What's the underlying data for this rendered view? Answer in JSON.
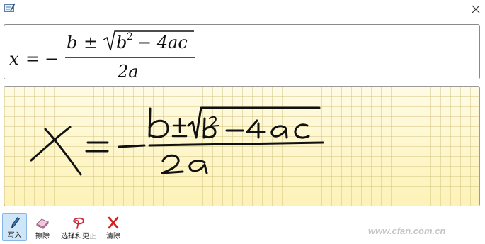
{
  "preview": {
    "lhs": "x",
    "eq": "=",
    "minus": "−",
    "numerator_b": "b",
    "pm": "±",
    "radicand_b": "b",
    "radicand_exp": "2",
    "radicand_rest": "− 4ac",
    "denominator": "2a"
  },
  "toolbar": {
    "write_label": "写入",
    "erase_label": "擦除",
    "select_correct_label": "选择和更正",
    "clear_label": "清除"
  },
  "watermark": "www.cfan.com.cn",
  "colors": {
    "ink": "#111111",
    "pad_background": "#fff9d6",
    "pad_grid": "#dccb80",
    "active_tool": "#cfe5f8",
    "clear_icon": "#d42020",
    "select_icon": "#c8283a"
  },
  "icons": {
    "app": "math-input-icon",
    "close": "close-icon",
    "write": "pen-icon",
    "erase": "eraser-icon",
    "select": "lasso-icon",
    "clear": "red-x-icon"
  }
}
